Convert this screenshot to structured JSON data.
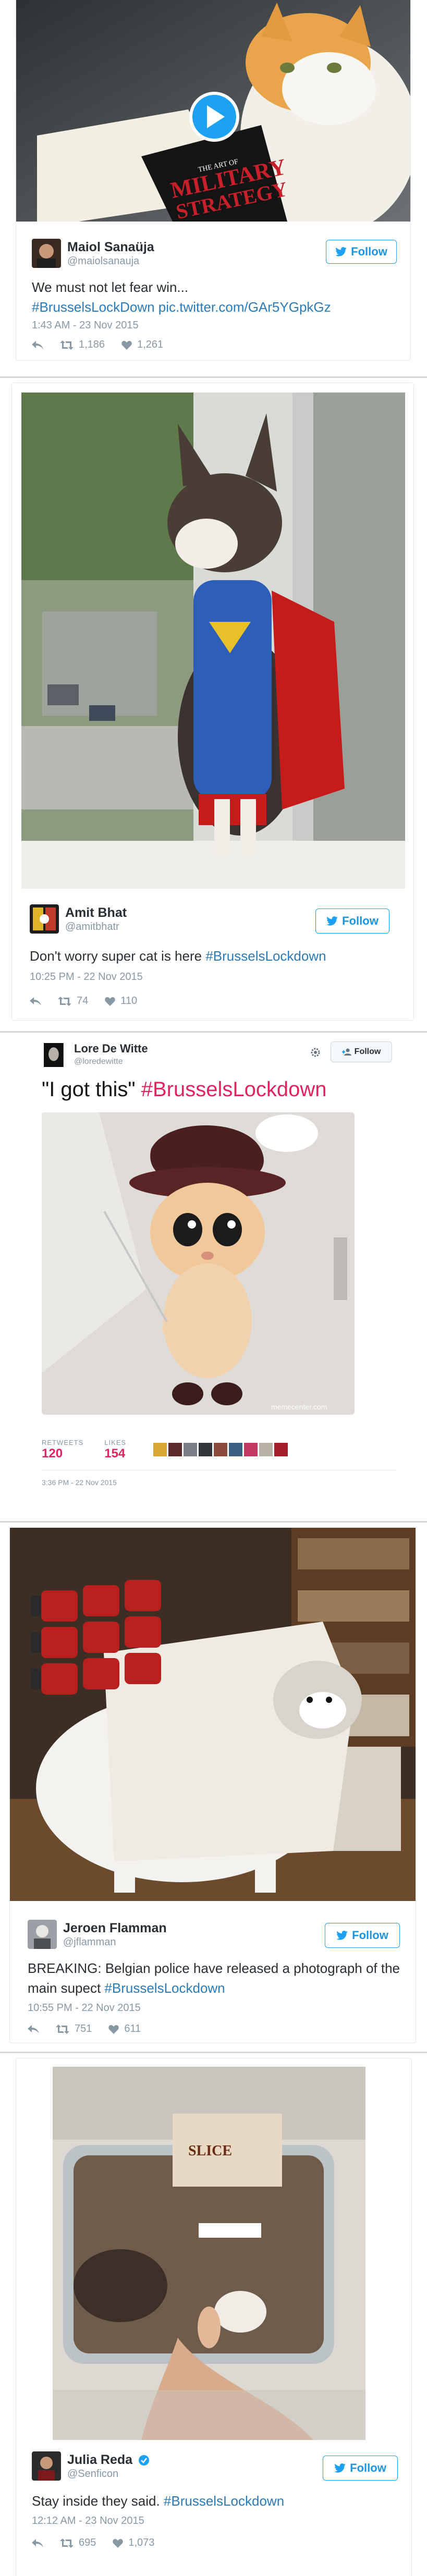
{
  "tweets": [
    {
      "name": "Maiol Sanaüja",
      "handle": "@maiolsanauja",
      "follow_label": "Follow",
      "text_plain": "We must not let fear win...",
      "text_link": "#BrusselsLockDown pic.twitter.com/GAr5YGpkGz",
      "timestamp": "1:43 AM - 23 Nov 2015",
      "retweets": "1,186",
      "likes": "1,261",
      "book_title_1": "THE ART OF",
      "book_title_2": "MILITARY",
      "book_title_3": "STRATEGY"
    },
    {
      "name": "Amit Bhat",
      "handle": "@amitbhatr",
      "follow_label": "Follow",
      "text_plain": "Don't worry super cat is here ",
      "text_link": "#BrusselsLockdown",
      "timestamp": "10:25 PM - 22 Nov 2015",
      "retweets": "74",
      "likes": "110"
    },
    {
      "name": "Lore De Witte",
      "handle": "@loredewitte",
      "follow_label": "Follow",
      "text_plain": "\"I got this\" ",
      "text_link": "#BrusselsLockdown",
      "retweets_label": "RETWEETS",
      "retweets": "120",
      "likes_label": "LIKES",
      "likes": "154",
      "timestamp": "3:36 PM - 22 Nov 2015",
      "watermark": "memecenter.com"
    },
    {
      "name": "Jeroen Flamman",
      "handle": "@jflamman",
      "follow_label": "Follow",
      "text_plain": "BREAKING: Belgian police have released a photograph of the main supect ",
      "text_link": "#BrusselsLockdown",
      "timestamp": "10:55 PM - 22 Nov 2015",
      "retweets": "751",
      "likes": "611"
    },
    {
      "name": "Julia Reda",
      "handle": "@Senficon",
      "follow_label": "Follow",
      "text_plain": "Stay inside they said. ",
      "text_link": "#BrusselsLockdown",
      "timestamp": "12:12 AM - 23 Nov 2015",
      "retweets": "695",
      "likes": "1,073",
      "box_label": "SLICE"
    }
  ],
  "colors": {
    "link": "#2b7bb9",
    "twitter_blue": "#1da1f2",
    "muted": "#8899a6",
    "like_red": "#e0245e"
  },
  "icons": [
    "play-icon",
    "reply-icon",
    "retweet-icon",
    "heart-icon",
    "twitter-bird-icon",
    "gear-icon",
    "add-user-icon",
    "verified-icon"
  ]
}
